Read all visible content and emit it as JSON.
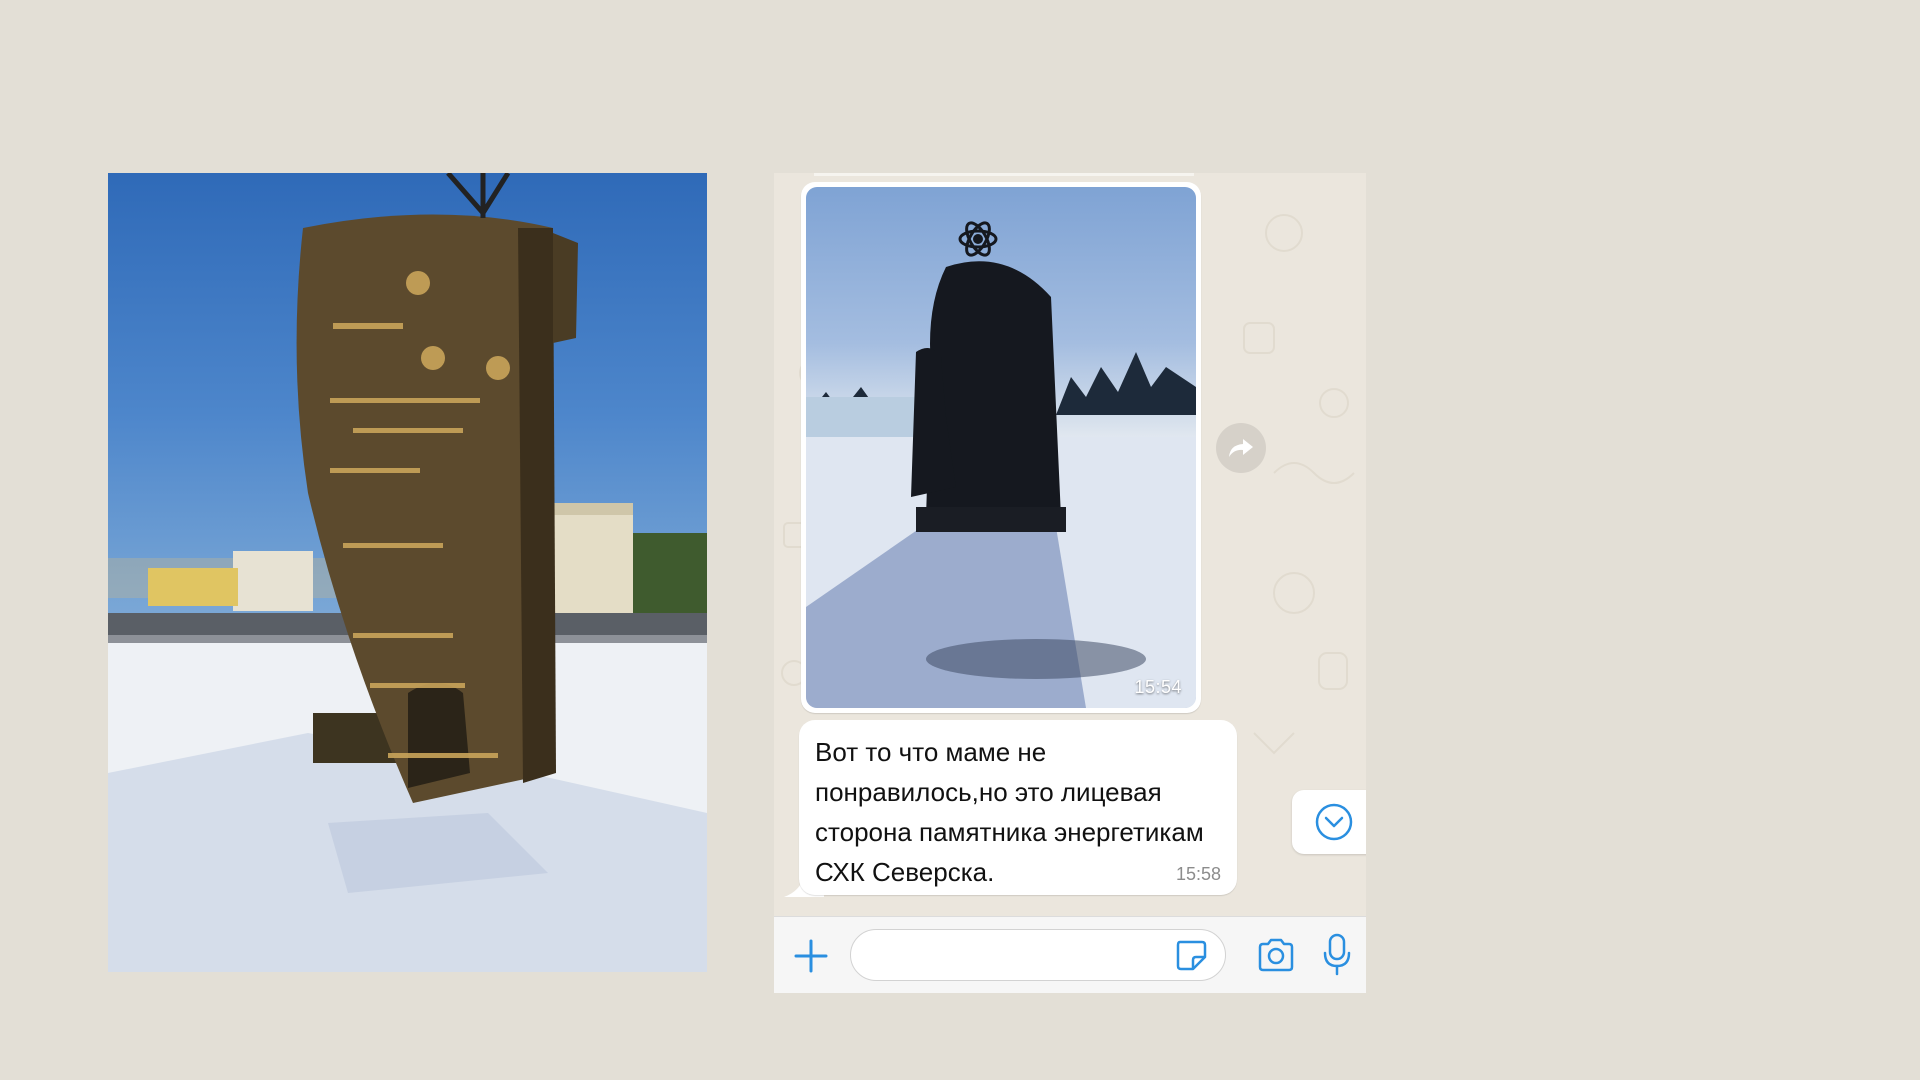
{
  "left_photo": {
    "icon": "monument-photo"
  },
  "chat": {
    "media_message": {
      "time": "15:54",
      "icon": "monument-photo"
    },
    "text_message": {
      "text": "Вот то что маме не\nпонравилось,но это лицевая\nсторона памятника энергетикам\nСХК Северска.",
      "time": "15:58"
    },
    "forward_icon": "forward-icon",
    "scroll_down_icon": "chevron-down-icon",
    "input_bar": {
      "input_value": "",
      "plus_icon": "plus-icon",
      "sticker_icon": "sticker-icon",
      "camera_icon": "camera-icon",
      "mic_icon": "microphone-icon"
    },
    "colors": {
      "accent": "#2a8fe0",
      "background": "#ebe6dd",
      "bubble": "#ffffff"
    }
  }
}
